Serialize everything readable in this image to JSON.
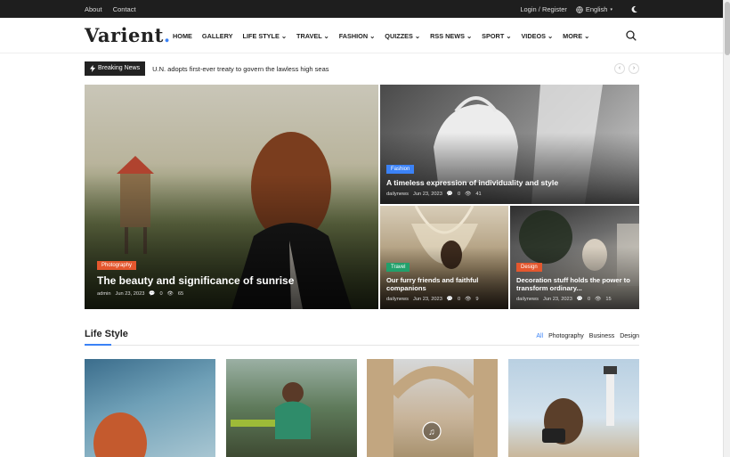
{
  "topbar": {
    "links": [
      "About",
      "Contact"
    ],
    "login": "Login / Register",
    "language": "English"
  },
  "header": {
    "logo": "Varient",
    "logo_dot": ".",
    "nav": [
      "HOME",
      "GALLERY",
      "LIFE STYLE",
      "TRAVEL",
      "FASHION",
      "QUIZZES",
      "RSS NEWS",
      "SPORT",
      "VIDEOS",
      "MORE"
    ]
  },
  "breaking": {
    "label": "Breaking News",
    "headline": "U.N. adopts first-ever treaty to govern the lawless high seas"
  },
  "featured": {
    "main": {
      "category": "Photography",
      "title": "The beauty and significance of sunrise",
      "author": "admin",
      "date": "Jun 23, 2023",
      "comments": "0",
      "views": "65",
      "cat_color": "#e4572e"
    },
    "top_right": {
      "category": "Fashion",
      "title": "A timeless expression of individuality and style",
      "author": "dailynews",
      "date": "Jun 23, 2023",
      "comments": "0",
      "views": "41",
      "cat_color": "#3b82f6"
    },
    "bottom_left": {
      "category": "Travel",
      "title": "Our furry friends and faithful companions",
      "author": "dailynews",
      "date": "Jun 23, 2023",
      "comments": "0",
      "views": "9",
      "cat_color": "#22a06b"
    },
    "bottom_right": {
      "category": "Design",
      "title": "Decoration stuff holds the power to transform ordinary...",
      "author": "dailynews",
      "date": "Jun 23, 2023",
      "comments": "0",
      "views": "15",
      "cat_color": "#e4572e"
    }
  },
  "section": {
    "title": "Life Style",
    "filters": [
      "All",
      "Photography",
      "Business",
      "Design"
    ],
    "accent": "#3b82f6"
  }
}
